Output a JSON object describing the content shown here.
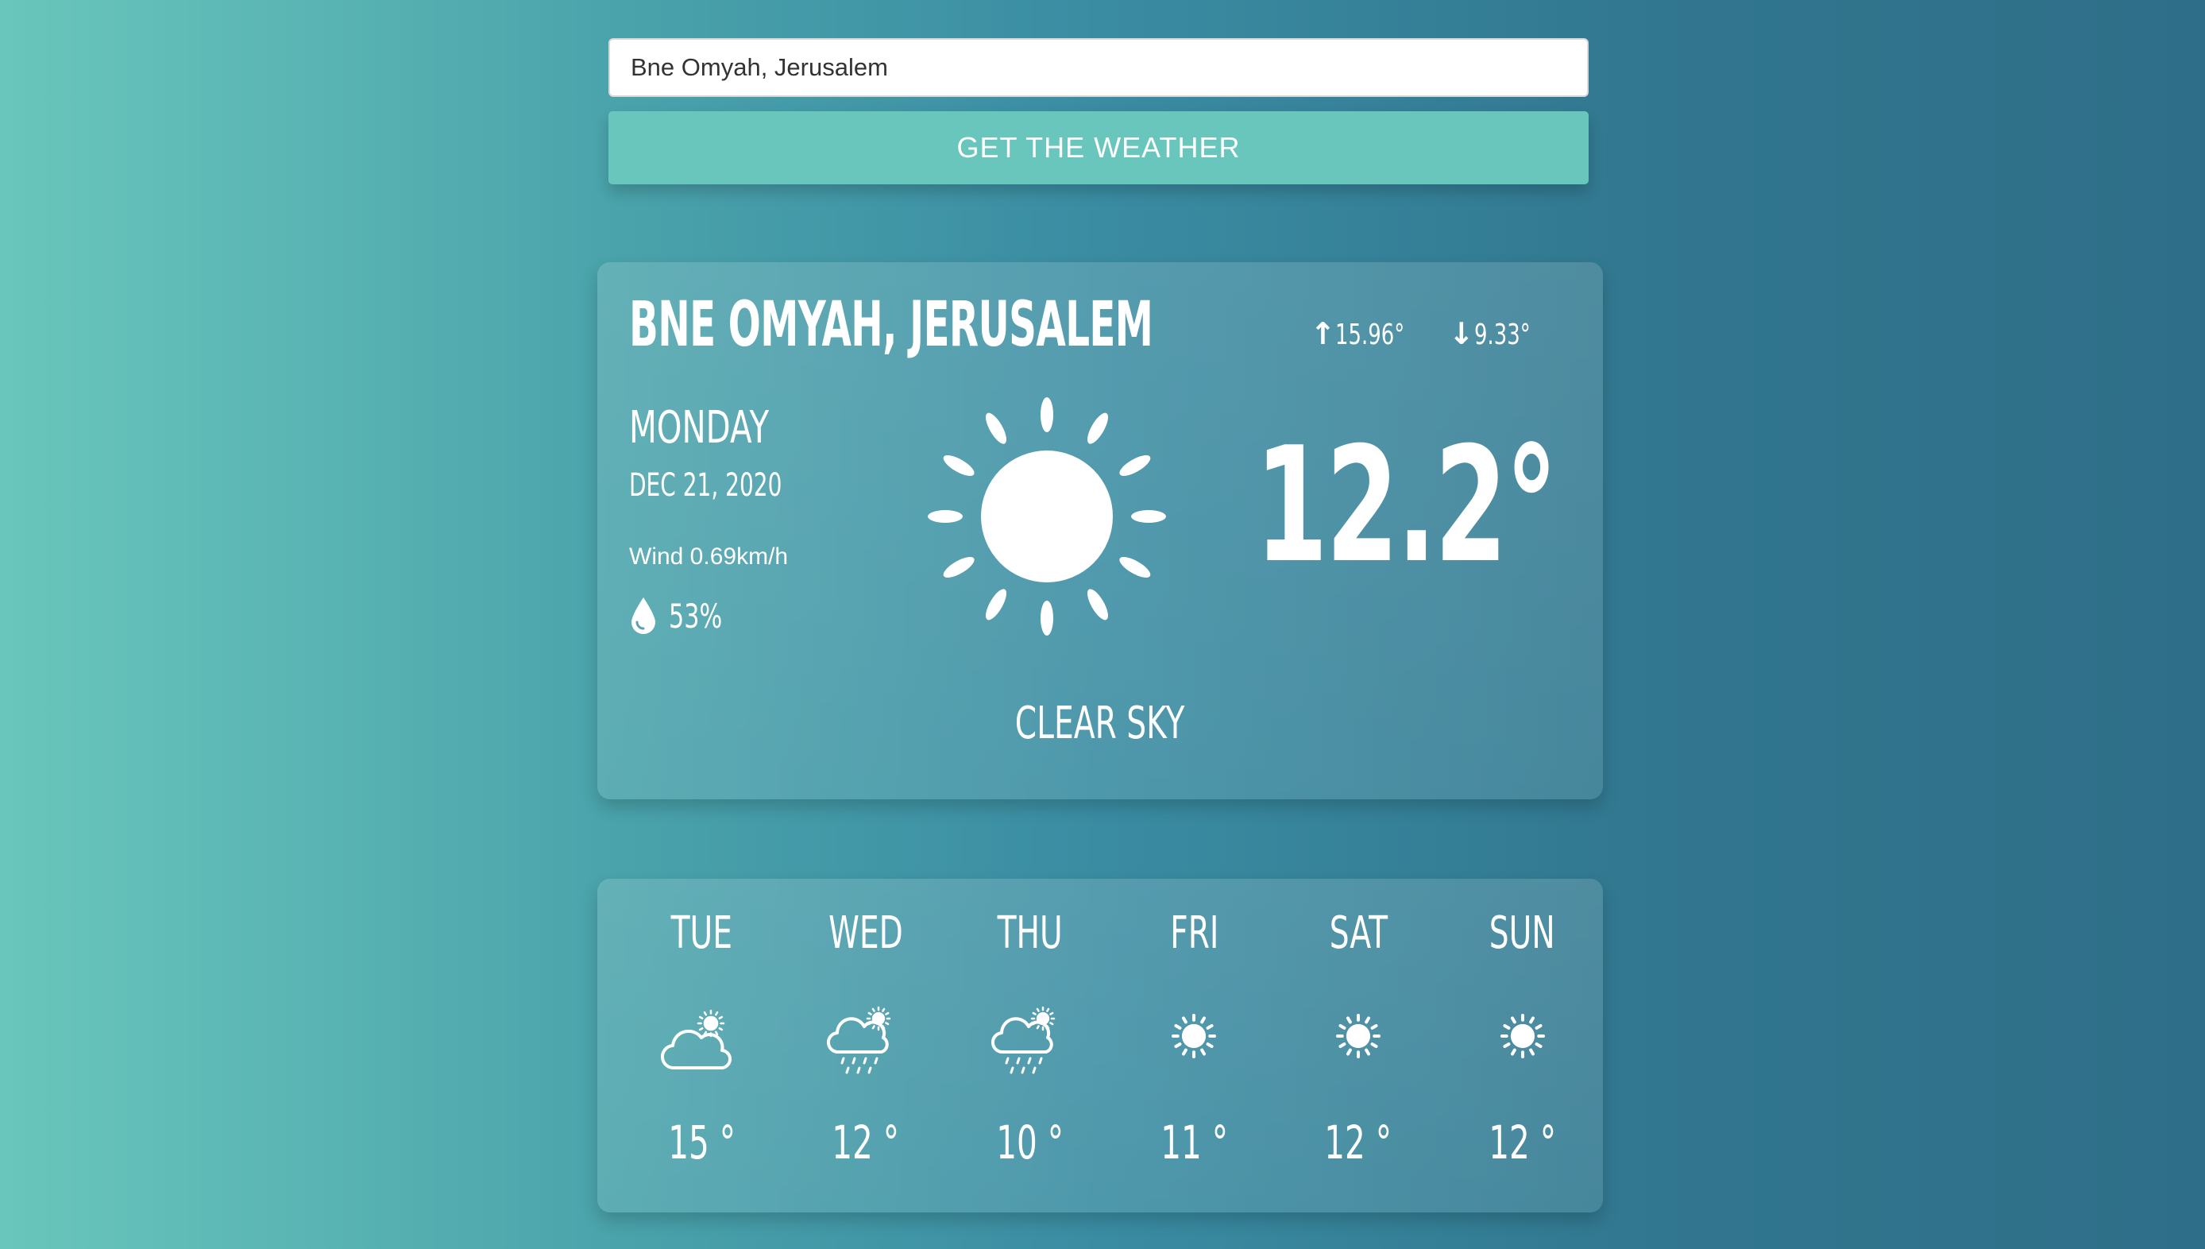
{
  "search": {
    "value": "Bne Omyah, Jerusalem"
  },
  "button": {
    "label": "GET THE WEATHER"
  },
  "current": {
    "city": "BNE OMYAH, JERUSALEM",
    "high": "15.96°",
    "low": "9.33°",
    "day": "MONDAY",
    "date": "DEC 21, 2020",
    "wind": "Wind 0.69km/h",
    "humidity": "53%",
    "temperature": "12.2°",
    "condition": "CLEAR SKY",
    "icon": "sun-icon"
  },
  "forecast": [
    {
      "day": "TUE",
      "temp": "15 °",
      "icon": "partly-cloudy-icon"
    },
    {
      "day": "WED",
      "temp": "12 °",
      "icon": "rain-sun-icon"
    },
    {
      "day": "THU",
      "temp": "10 °",
      "icon": "rain-sun-icon"
    },
    {
      "day": "FRI",
      "temp": "11 °",
      "icon": "sun-icon"
    },
    {
      "day": "SAT",
      "temp": "12 °",
      "icon": "sun-icon"
    },
    {
      "day": "SUN",
      "temp": "12 °",
      "icon": "sun-icon"
    }
  ],
  "colors": {
    "button": "#68c6bc",
    "gradient_start": "#69c6bc",
    "gradient_end": "#2f6e88"
  }
}
